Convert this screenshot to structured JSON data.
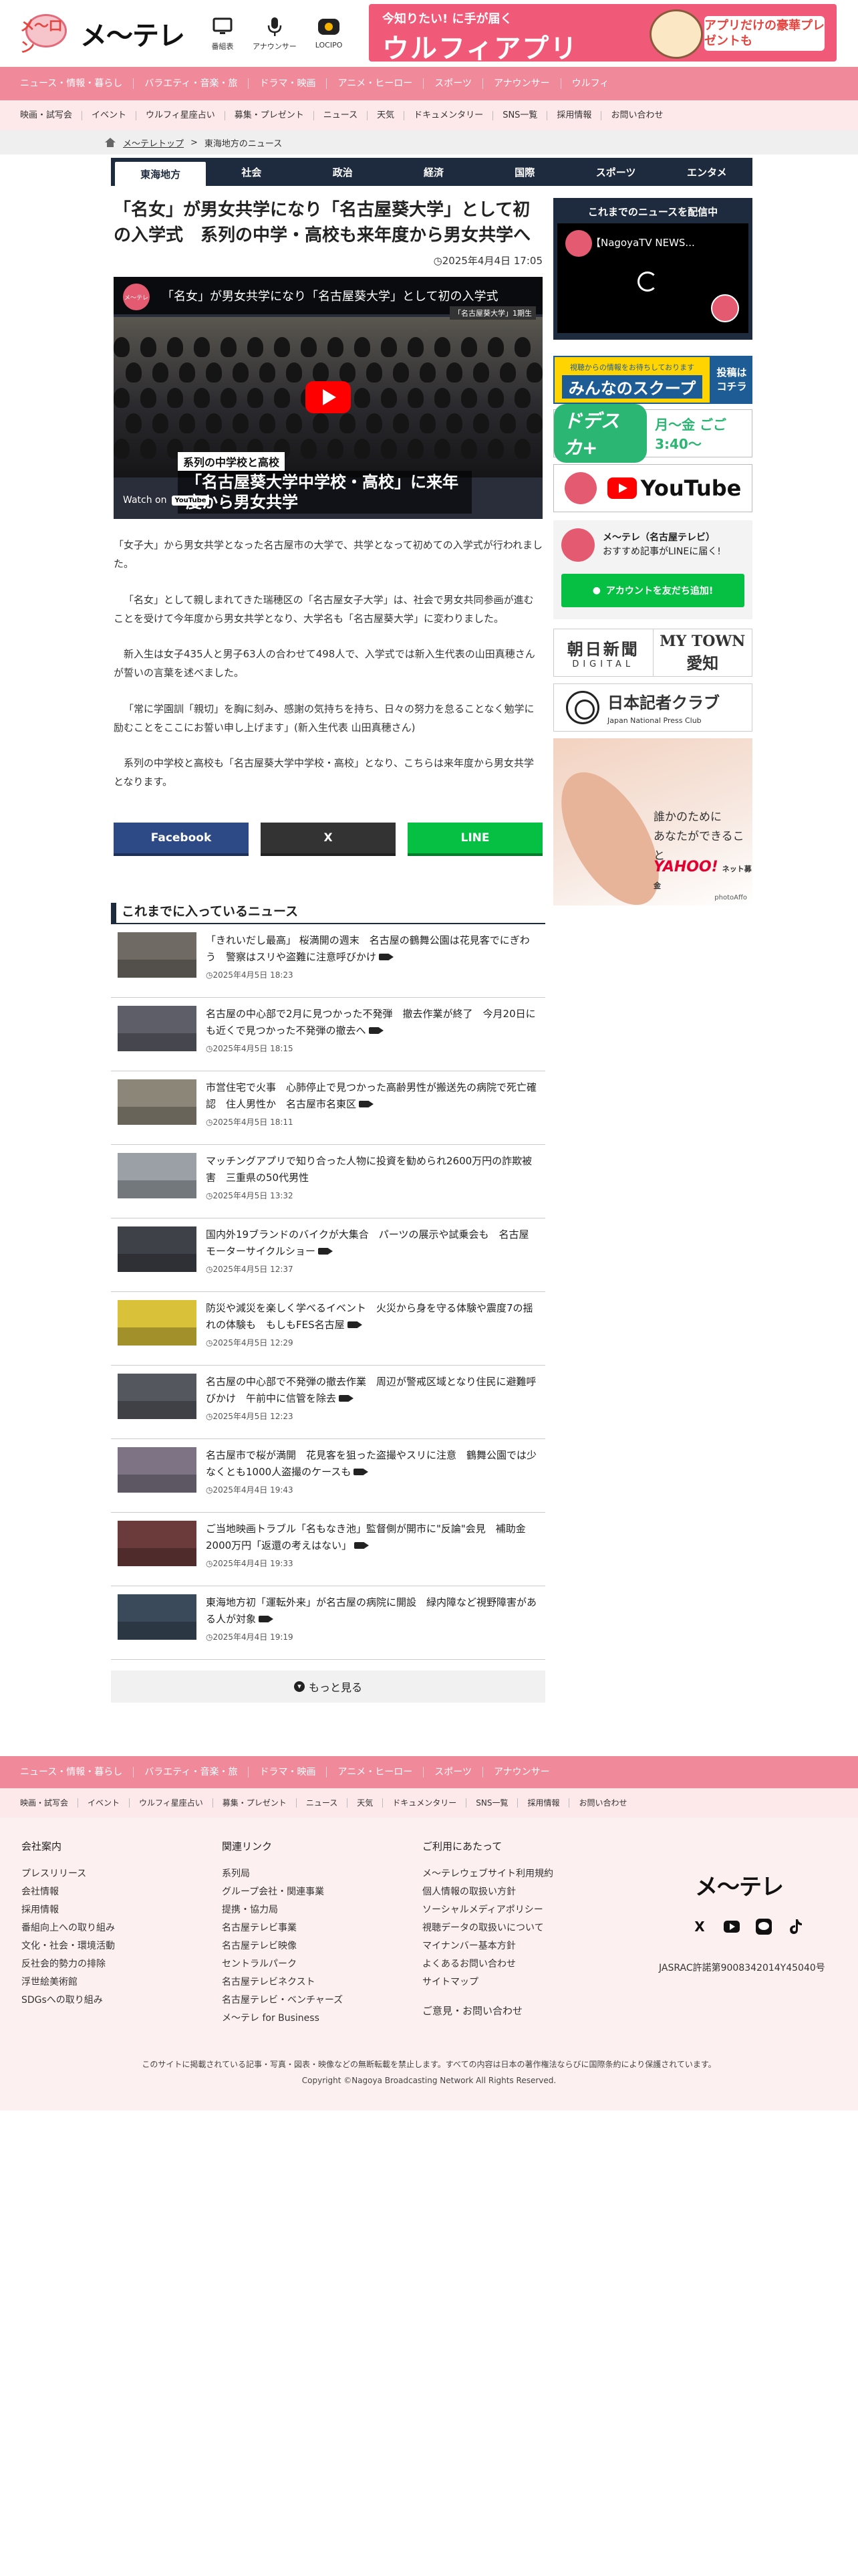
{
  "header": {
    "logo_mascot_text": "メ〜ロン",
    "logo_text": "メ〜テレ",
    "icons": [
      {
        "label": "番組表",
        "icon": "tv-icon"
      },
      {
        "label": "アナウンサー",
        "icon": "microphone-icon"
      },
      {
        "label": "LOCIPO",
        "icon": "locipo-icon"
      }
    ],
    "app_banner": {
      "line1": "今知りたい! に手が届く",
      "line2": "ウルフィアプリ",
      "cta": "アプリだけの豪華プレゼントも"
    }
  },
  "nav_primary": [
    "ニュース・情報・暮らし",
    "バラエティ・音楽・旅",
    "ドラマ・映画",
    "アニメ・ヒーロー",
    "スポーツ",
    "アナウンサー",
    "ウルフィ"
  ],
  "nav_secondary": [
    "映画・試写会",
    "イベント",
    "ウルフィ星座占い",
    "募集・プレゼント",
    "ニュース",
    "天気",
    "ドキュメンタリー",
    "SNS一覧",
    "採用情報",
    "お問い合わせ"
  ],
  "breadcrumb": {
    "home": "メ〜テレトップ",
    "sep": ">",
    "current": "東海地方のニュース"
  },
  "category_tabs": [
    "東海地方",
    "社会",
    "政治",
    "経済",
    "国際",
    "スポーツ",
    "エンタメ"
  ],
  "article": {
    "title": "「名女」が男女共学になり「名古屋葵大学」として初の入学式　系列の中学・高校も来年度から男女共学へ",
    "date": "2025年4月4日 17:05",
    "video": {
      "channel": "メ〜テレ",
      "title": "「名女」が男女共学になり「名古屋葵大学」として初の入学式",
      "caption_small": "系列の中学校と高校",
      "caption_large": "「名古屋葵大学中学校・高校」に来年度から男女共学",
      "watch_on": "Watch on",
      "youtube": "YouTube",
      "tag": "「名古屋葵大学」1期生"
    },
    "paragraphs": [
      "「女子大」から男女共学となった名古屋市の大学で、共学となって初めての入学式が行われました。",
      "「名女」として親しまれてきた瑞穂区の「名古屋女子大学」は、社会で男女共同参画が進むことを受けて今年度から男女共学となり、大学名も「名古屋葵大学」に変わりました。",
      "新入生は女子435人と男子63人の合わせて498人で、入学式では新入生代表の山田真穂さんが誓いの言葉を述べました。",
      "「常に学園訓「親切」を胸に刻み、感謝の気持ちを持ち、日々の努力を怠ることなく勉学に励むことをここにお誓い申し上げます」(新入生代表 山田真穂さん)",
      "系列の中学校と高校も「名古屋葵大学中学校・高校」となり、こちらは来年度から男女共学となります。"
    ]
  },
  "share": {
    "facebook": "Facebook",
    "x": "X",
    "line": "LINE"
  },
  "news": {
    "heading": "これまでに入っているニュース",
    "items": [
      {
        "title": "「きれいだし最高」 桜満開の週末　名古屋の鶴舞公園は花見客でにぎわう　警察はスリや盗難に注意呼びかけ",
        "date": "2025年4月5日 18:23",
        "video": true,
        "thumb": "#6f6a64"
      },
      {
        "title": "名古屋の中心部で2月に見つかった不発弾　撤去作業が終了　今月20日にも近くで見つかった不発弾の撤去へ",
        "date": "2025年4月5日 18:15",
        "video": true,
        "thumb": "#5d5e68"
      },
      {
        "title": "市営住宅で火事　心肺停止で見つかった高齢男性が搬送先の病院で死亡確認　住人男性か　名古屋市名東区",
        "date": "2025年4月5日 18:11",
        "video": true,
        "thumb": "#8b8677"
      },
      {
        "title": "マッチングアプリで知り合った人物に投資を勧められ2600万円の詐欺被害　三重県の50代男性",
        "date": "2025年4月5日 13:32",
        "video": false,
        "thumb": "#9aa0a6"
      },
      {
        "title": "国内外19ブランドのバイクが大集合　パーツの展示や試乗会も　名古屋モーターサイクルショー",
        "date": "2025年4月5日 12:37",
        "video": true,
        "thumb": "#3e4148"
      },
      {
        "title": "防災や減災を楽しく学べるイベント　火災から身を守る体験や震度7の揺れの体験も　もしもFES名古屋",
        "date": "2025年4月5日 12:29",
        "video": true,
        "thumb": "#d9c23a"
      },
      {
        "title": "名古屋の中心部で不発弾の撤去作業　周辺が警戒区域となり住民に避難呼びかけ　午前中に信管を除去",
        "date": "2025年4月5日 12:23",
        "video": true,
        "thumb": "#55575e"
      },
      {
        "title": "名古屋市で桜が満開　花見客を狙った盗撮やスリに注意　鶴舞公園では少なくとも1000人盗撮のケースも",
        "date": "2025年4月4日 19:43",
        "video": true,
        "thumb": "#7d7385"
      },
      {
        "title": "ご当地映画トラブル「名もなき池」監督側が開市に\"反論\"会見　補助金2000万円「返還の考えはない」",
        "date": "2025年4月4日 19:33",
        "video": true,
        "thumb": "#6b3a3a"
      },
      {
        "title": "東海地方初「運転外来」が名古屋の病院に開設　緑内障など視野障害がある人が対象",
        "date": "2025年4月4日 19:19",
        "video": true,
        "thumb": "#3a4a5a"
      }
    ],
    "more": "もっと見る"
  },
  "sidebar": {
    "live_heading": "これまでのニュースを配信中",
    "live_title": "【NagoyaTV NEWS...",
    "scoop_small": "視聴からの情報をお待ちしております",
    "scoop_big": "みんなのスクープ",
    "scoop_cta1": "投稿は",
    "scoop_cta2": "コチラ",
    "dora_logo": "ドデスカ+",
    "dora_time": "月〜金 ごご3:40〜",
    "youtube": "YouTube",
    "line_title": "メ〜テレ（名古屋テレビ）",
    "line_sub": "おすすめ記事がLINEに届く!",
    "line_btn": "アカウントを友だち追加!",
    "asahi_top": "朝日新聞",
    "asahi_bottom": "DIGITAL",
    "mytown_top": "MY TOWN",
    "mytown_bottom": "愛知",
    "press_top": "日本記者クラブ",
    "press_bottom": "Japan National Press Club",
    "yahoo_msg1": "誰かのために",
    "yahoo_msg2": "あなたができること",
    "yahoo_logo": "YAHOO!",
    "yahoo_sub": "ネット募金",
    "yahoo_cap": "photoAffo"
  },
  "footer": {
    "nav_primary": [
      "ニュース・情報・暮らし",
      "バラエティ・音楽・旅",
      "ドラマ・映画",
      "アニメ・ヒーロー",
      "スポーツ",
      "アナウンサー"
    ],
    "nav_secondary": [
      "映画・試写会",
      "イベント",
      "ウルフィ星座占い",
      "募集・プレゼント",
      "ニュース",
      "天気",
      "ドキュメンタリー",
      "SNS一覧",
      "採用情報",
      "お問い合わせ"
    ],
    "col1": {
      "heading": "会社案内",
      "links": [
        "プレスリリース",
        "会社情報",
        "採用情報",
        "番組向上への取り組み",
        "文化・社会・環境活動",
        "反社会的勢力の排除",
        "浮世絵美術館",
        "SDGsへの取り組み"
      ]
    },
    "col2": {
      "heading": "関連リンク",
      "links": [
        "系列局",
        "グループ会社・関連事業",
        "提携・協力局",
        "名古屋テレビ事業",
        "名古屋テレビ映像",
        "セントラルパーク",
        "名古屋テレビネクスト",
        "名古屋テレビ・ベンチャーズ",
        "メ〜テレ for Business"
      ]
    },
    "col3": {
      "heading": "ご利用にあたって",
      "links": [
        "メ〜テレウェブサイト利用規約",
        "個人情報の取扱い方針",
        "ソーシャルメディアポリシー",
        "視聴データの取扱いについて",
        "マイナンバー基本方針",
        "よくあるお問い合わせ",
        "サイトマップ"
      ],
      "extra": "ご意見・お問い合わせ"
    },
    "logo": "メ〜テレ",
    "social": [
      "X",
      "YouTube",
      "LINE",
      "TikTok"
    ],
    "jasrac": "JASRAC許諾第9008342014Y45040号",
    "copy1": "このサイトに掲載されている記事・写真・図表・映像などの無断転載を禁止します。すべての内容は日本の著作権法ならびに国際条約により保護されています。",
    "copy2": "Copyright ©Nagoya Broadcasting Network All Rights Reserved."
  }
}
